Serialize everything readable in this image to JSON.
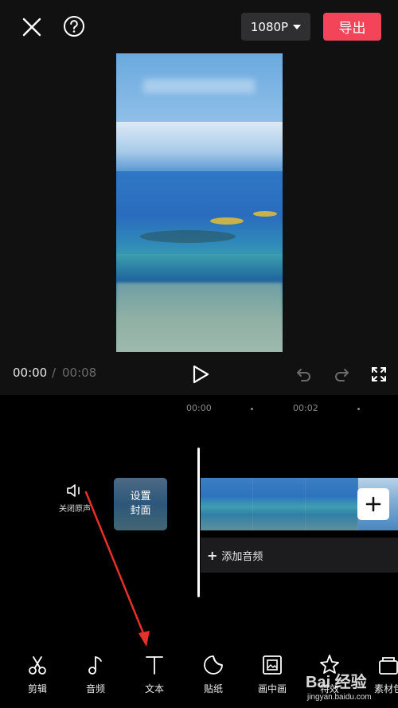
{
  "header": {
    "resolution_label": "1080P",
    "export_label": "导出"
  },
  "player": {
    "current_time": "00:00",
    "separator": "/",
    "total_time": "00:08"
  },
  "timeline": {
    "ruler_ticks": [
      "00:00",
      "00:02"
    ],
    "mute_label": "关闭原声",
    "cover_label": "设置封面",
    "add_audio_label": "添加音频"
  },
  "toolbar": {
    "items": [
      {
        "label": "剪辑",
        "icon": "scissors-icon"
      },
      {
        "label": "音频",
        "icon": "music-note-icon"
      },
      {
        "label": "文本",
        "icon": "text-icon"
      },
      {
        "label": "贴纸",
        "icon": "sticker-icon"
      },
      {
        "label": "画中画",
        "icon": "picture-in-picture-icon"
      },
      {
        "label": "特效",
        "icon": "effects-star-icon"
      },
      {
        "label": "素材包",
        "icon": "material-pack-icon"
      }
    ]
  },
  "watermark": {
    "brand": "Bai 经验",
    "url": "jingyan.baidu.com"
  },
  "colors": {
    "accent": "#f4445a",
    "background": "#111112",
    "timeline_bg": "#000000"
  }
}
